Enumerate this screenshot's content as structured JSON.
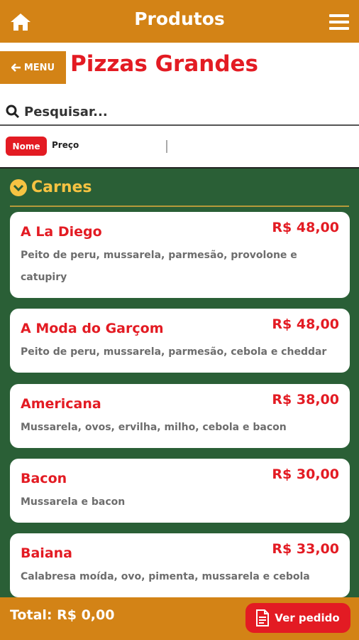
{
  "header": {
    "title": "Produtos",
    "home_icon": "home-icon",
    "menu_icon": "hamburger-icon"
  },
  "nav": {
    "back_label": "MENU",
    "page_title": "Pizzas Grandes"
  },
  "search": {
    "placeholder": "Pesquisar..."
  },
  "sort": {
    "active": "Nome",
    "other": "Preço"
  },
  "category": {
    "name": "Carnes"
  },
  "products": [
    {
      "name": "A La Diego",
      "price": "R$ 48,00",
      "desc": "Peito de peru, mussarela, parmesão, provolone e catupiry"
    },
    {
      "name": "A Moda do Garçom",
      "price": "R$ 48,00",
      "desc": "Peito de peru, mussarela, parmesão, cebola e cheddar"
    },
    {
      "name": "Americana",
      "price": "R$ 38,00",
      "desc": "Mussarela, ovos, ervilha, milho, cebola e bacon"
    },
    {
      "name": "Bacon",
      "price": "R$ 30,00",
      "desc": "Mussarela e bacon"
    },
    {
      "name": "Baiana",
      "price": "R$ 33,00",
      "desc": "Calabresa moída, ovo, pimenta, mussarela e cebola"
    }
  ],
  "footer": {
    "total": "Total: R$ 0,00",
    "order_button": "Ver pedido"
  },
  "colors": {
    "brand": "#d38316",
    "accent": "#e31b23",
    "background": "#2a5f36",
    "category": "#f6c342"
  }
}
